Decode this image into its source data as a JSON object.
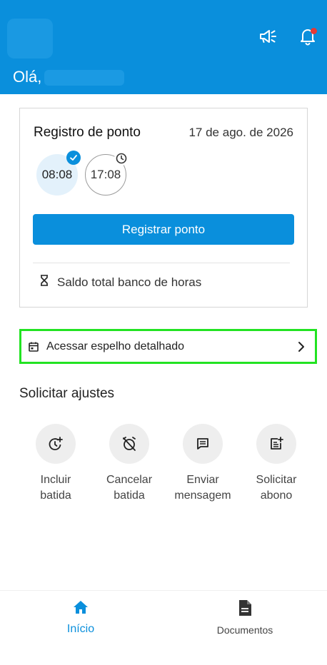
{
  "header": {
    "greeting": "Olá,",
    "icons": [
      "megaphone-icon",
      "bell-icon"
    ],
    "notification_dot": true
  },
  "registro": {
    "title": "Registro de ponto",
    "date": "17 de ago. de 2026",
    "punches": [
      {
        "time": "08:08",
        "status": "done"
      },
      {
        "time": "17:08",
        "status": "pending"
      }
    ],
    "button_label": "Registrar ponto",
    "saldo_label": "Saldo total banco de horas"
  },
  "espelho": {
    "label": "Acessar espelho detalhado"
  },
  "ajustes": {
    "title": "Solicitar ajustes",
    "actions": [
      {
        "line1": "Incluir",
        "line2": "batida",
        "icon": "add-clock-icon"
      },
      {
        "line1": "Cancelar",
        "line2": "batida",
        "icon": "alarm-off-icon"
      },
      {
        "line1": "Enviar",
        "line2": "mensagem",
        "icon": "message-icon"
      },
      {
        "line1": "Solicitar",
        "line2": "abono",
        "icon": "post-add-icon"
      }
    ]
  },
  "nav": {
    "home_label": "Início",
    "docs_label": "Documentos"
  },
  "colors": {
    "primary": "#0a8fdc",
    "highlight_border": "#22e322",
    "notification": "#e53935"
  }
}
